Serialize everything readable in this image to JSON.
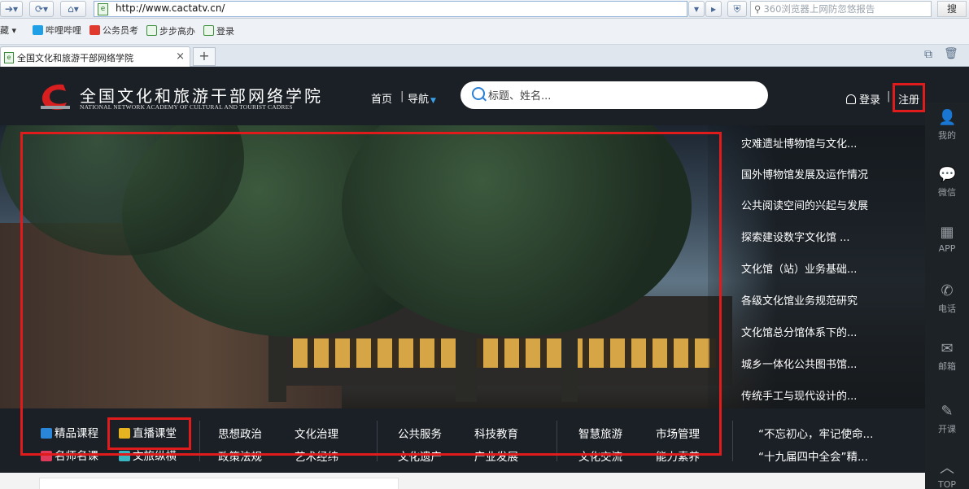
{
  "browser": {
    "url": "http://www.cactatv.cn/",
    "search_placeholder": "360浏览器上网防忽悠报告",
    "search_button": "搜",
    "favorites_label": "藏",
    "favorites": [
      "哔哩哔哩",
      "公务员考",
      "步步高办",
      "登录"
    ],
    "tab_title": "全国文化和旅游干部网络学院",
    "tab_close": "×",
    "new_tab": "+"
  },
  "header": {
    "logo_cn": "全国文化和旅游干部网络学院",
    "logo_en": "NATIONAL NETWORK ACADEMY OF CULTURAL AND TOURIST CADRES",
    "nav_home": "首页",
    "nav_sep": "|",
    "nav_guide": "导航",
    "search_placeholder": "标题、姓名...",
    "login": "登录",
    "login_sep": "|",
    "register": "注册"
  },
  "news": [
    "灾难遗址博物馆与文化...",
    "国外博物馆发展及运作情况",
    "公共阅读空间的兴起与发展",
    "探索建设数字文化馆 ...",
    "文化馆（站）业务基础...",
    "各级文化馆业务规范研究",
    "文化馆总分馆体系下的...",
    "城乡一体化公共图书馆...",
    "传统手工与现代设计的..."
  ],
  "sidebar": {
    "mine": "我的",
    "wechat": "微信",
    "app": "APP",
    "phone": "电话",
    "mail": "邮箱",
    "open_course": "开课",
    "top": "TOP"
  },
  "categories": {
    "featured": "精品课程",
    "live": "直播课堂",
    "masters": "名师名课",
    "culture_tour": "文旅纵横",
    "politics": "思想政治",
    "policy": "政策法规",
    "governance": "文化治理",
    "arts": "艺术经纬",
    "public_service": "公共服务",
    "heritage": "文化遗产",
    "tech_edu": "科技教育",
    "industry": "产业发展",
    "smart_tour": "智慧旅游",
    "exchange": "文化交流",
    "market": "市场管理",
    "ability": "能力素养",
    "promo1": "“不忘初心，牢记使命...",
    "promo2": "“十九届四中全会”精..."
  },
  "colors": {
    "highlight": "#e01b1b",
    "accent_blue": "#2a7fd6",
    "site_bg": "#1b2026"
  }
}
